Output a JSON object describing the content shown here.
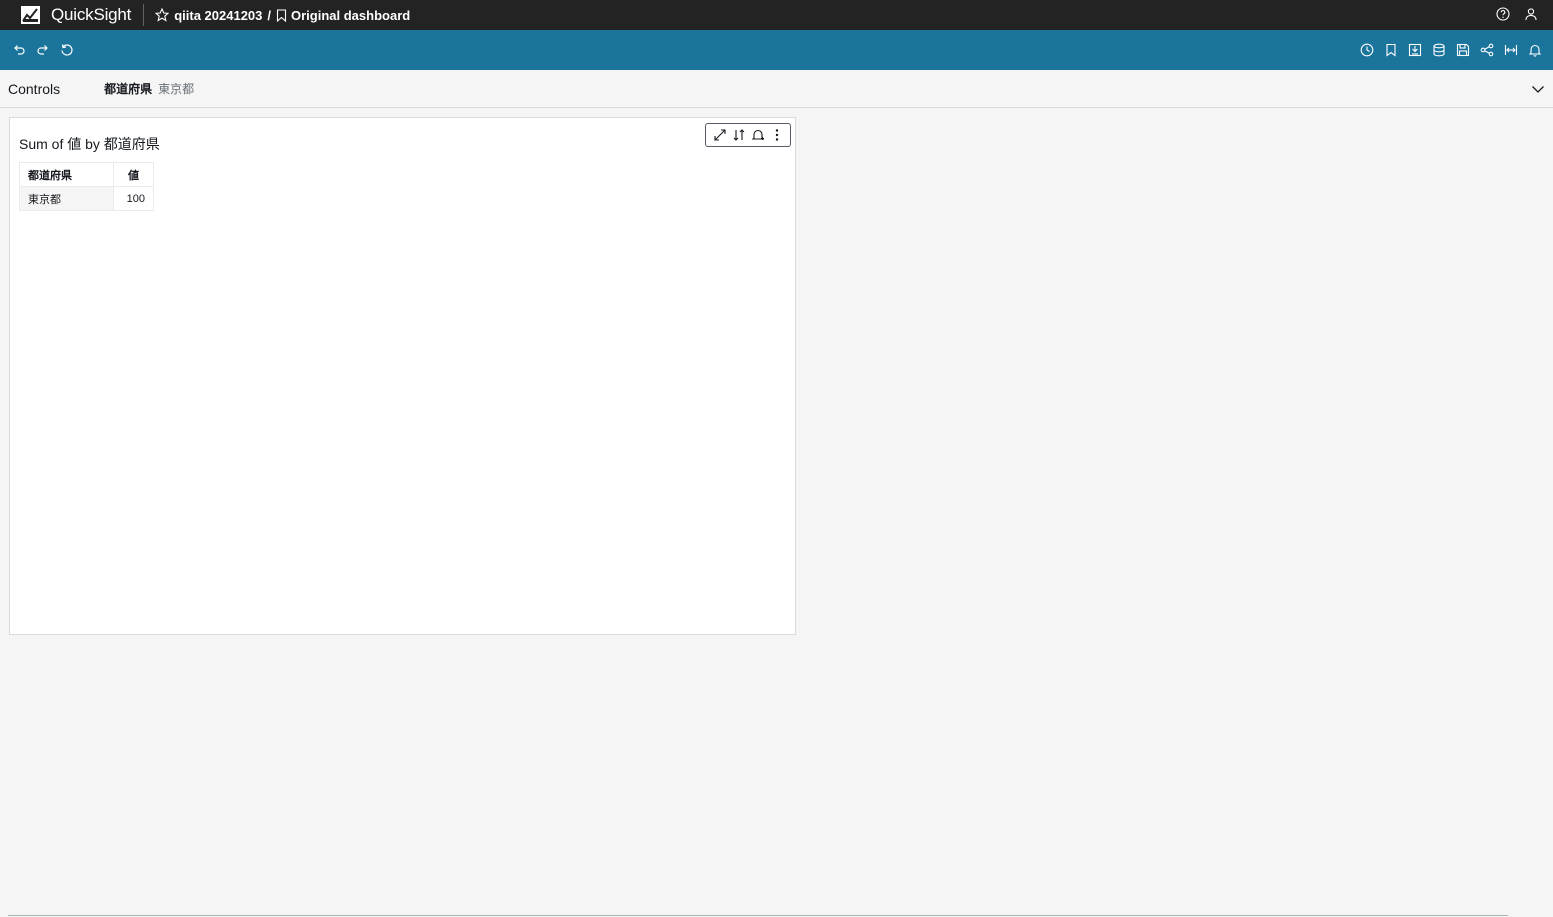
{
  "app": {
    "name": "QuickSight"
  },
  "breadcrumb": {
    "analysis": "qiita 20241203",
    "separator": "/",
    "dashboard": "Original dashboard"
  },
  "top_icons": [
    "help-icon",
    "user-icon"
  ],
  "toolbar": {
    "left_icons": [
      "undo-icon",
      "redo-icon",
      "reset-icon"
    ],
    "right_icons": [
      "history-icon",
      "bookmark-icon",
      "export-icon",
      "dataset-icon",
      "save-icon",
      "share-icon",
      "fit-width-icon",
      "alert-icon"
    ]
  },
  "controls": {
    "label": "Controls",
    "filter_name": "都道府県",
    "filter_value": "東京都"
  },
  "visual": {
    "title": "Sum of 値 by 都道府県",
    "menu_icons": [
      "expand-icon",
      "sort-icon",
      "alert-add-icon",
      "more-options-icon"
    ],
    "table": {
      "columns": [
        "都道府県",
        "値"
      ],
      "rows": [
        [
          "東京都",
          "100"
        ]
      ]
    }
  },
  "colors": {
    "topbar": "#232323",
    "toolbar": "#1a749c",
    "background": "#f5f5f5"
  }
}
